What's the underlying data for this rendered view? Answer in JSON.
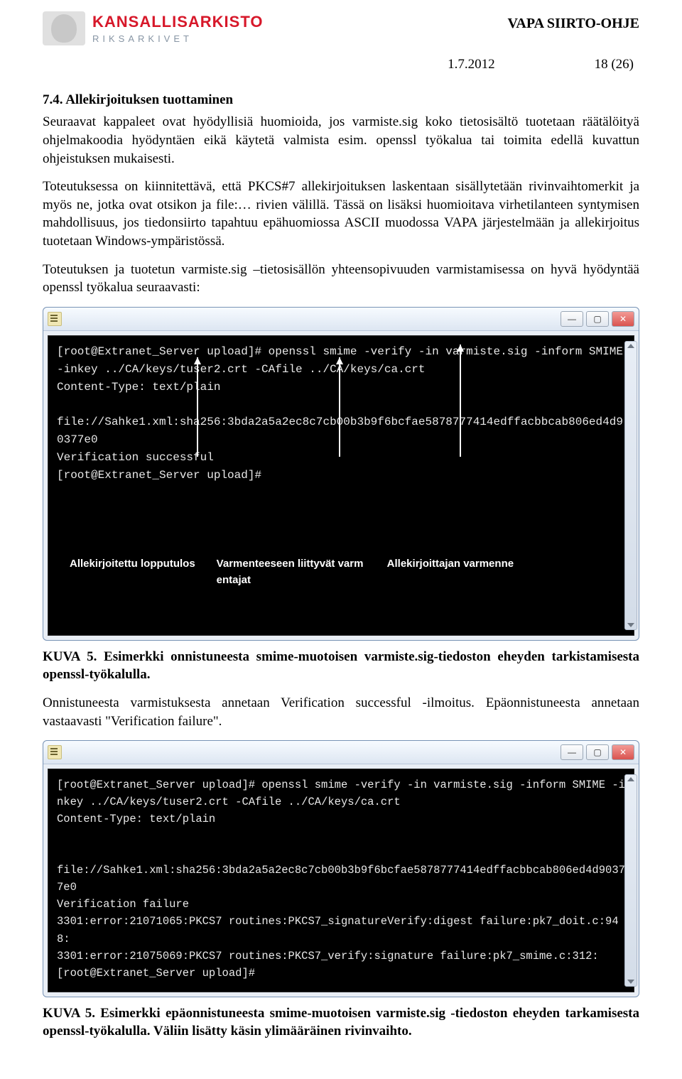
{
  "header": {
    "brand_main": "KANSALLISARKISTO",
    "brand_sub": "RIKSARKIVET",
    "doc_title": "VAPA SIIRTO-OHJE",
    "date": "1.7.2012",
    "page": "18 (26)"
  },
  "section": {
    "heading": "7.4. Allekirjoituksen tuottaminen",
    "para1": "Seuraavat kappaleet ovat hyödyllisiä huomioida, jos varmiste.sig koko tietosisältö tuotetaan räätälöityä ohjelmakoodia hyödyntäen eikä käytetä valmista esim. openssl työkalua tai toimita edellä kuvattun ohjeistuksen mukaisesti.",
    "para2": "Toteutuksessa on kiinnitettävä, että PKCS#7 allekirjoituksen laskentaan sisällytetään rivinvaihtomerkit ja myös ne, jotka ovat otsikon ja file:… rivien välillä. Tässä on lisäksi huomioitava virhetilanteen syntymisen mahdollisuus, jos tiedonsiirto tapahtuu epähuomiossa ASCII muodossa VAPA järjestelmään ja allekirjoitus tuotetaan Windows-ympäristössä.",
    "para3": "Toteutuksen ja tuotetun varmiste.sig –tietosisällön yhteensopivuuden varmistamisessa on hyvä hyödyntää openssl työkalua seuraavasti:"
  },
  "terminal1": {
    "line1": "[root@Extranet_Server upload]# openssl smime -verify -in varmiste.sig -inform SMIME -inkey ../CA/keys/tuser2.crt -CAfile ../CA/keys/ca.crt",
    "line2": "Content-Type: text/plain",
    "line3": "",
    "line4": "file://Sahke1.xml:sha256:3bda2a5a2ec8c7cb00b3b9f6bcfae5878777414edffacbbcab806ed4d90377e0",
    "line5": "Verification successful",
    "line6": "[root@Extranet_Server upload]#"
  },
  "annotations": {
    "label1": "Allekirjoitettu lopputulos",
    "label2": "Varmenteeseen liittyvät varmentajat",
    "label3": "Allekirjoittajan varmenne"
  },
  "caption1": "KUVA 5. Esimerkki onnistuneesta smime-muotoisen varmiste.sig-tiedoston eheyden tarkistamisesta openssl-työkalulla.",
  "para_after1": "Onnistuneesta varmistuksesta annetaan Verification successful -ilmoitus. Epäonnistuneesta annetaan vastaavasti \"Verification failure\".",
  "terminal2": {
    "line1": "[root@Extranet_Server upload]# openssl smime -verify -in varmiste.sig -inform SMIME -inkey ../CA/keys/tuser2.crt -CAfile ../CA/keys/ca.crt",
    "line2": "Content-Type: text/plain",
    "line3": "",
    "line4": "",
    "line5": "file://Sahke1.xml:sha256:3bda2a5a2ec8c7cb00b3b9f6bcfae5878777414edffacbbcab806ed4d90377e0",
    "line6": "Verification failure",
    "line7": "3301:error:21071065:PKCS7 routines:PKCS7_signatureVerify:digest failure:pk7_doit.c:948:",
    "line8": "3301:error:21075069:PKCS7 routines:PKCS7_verify:signature failure:pk7_smime.c:312:",
    "line9": "[root@Extranet_Server upload]#"
  },
  "caption2": "KUVA 5. Esimerkki epäonnistuneesta smime-muotoisen varmiste.sig -tiedoston eheyden tarkamisesta openssl-työkalulla. Väliin lisätty käsin ylimääräinen rivinvaihto.",
  "winbtns": {
    "min": "—",
    "max": "▢",
    "close": "✕"
  }
}
